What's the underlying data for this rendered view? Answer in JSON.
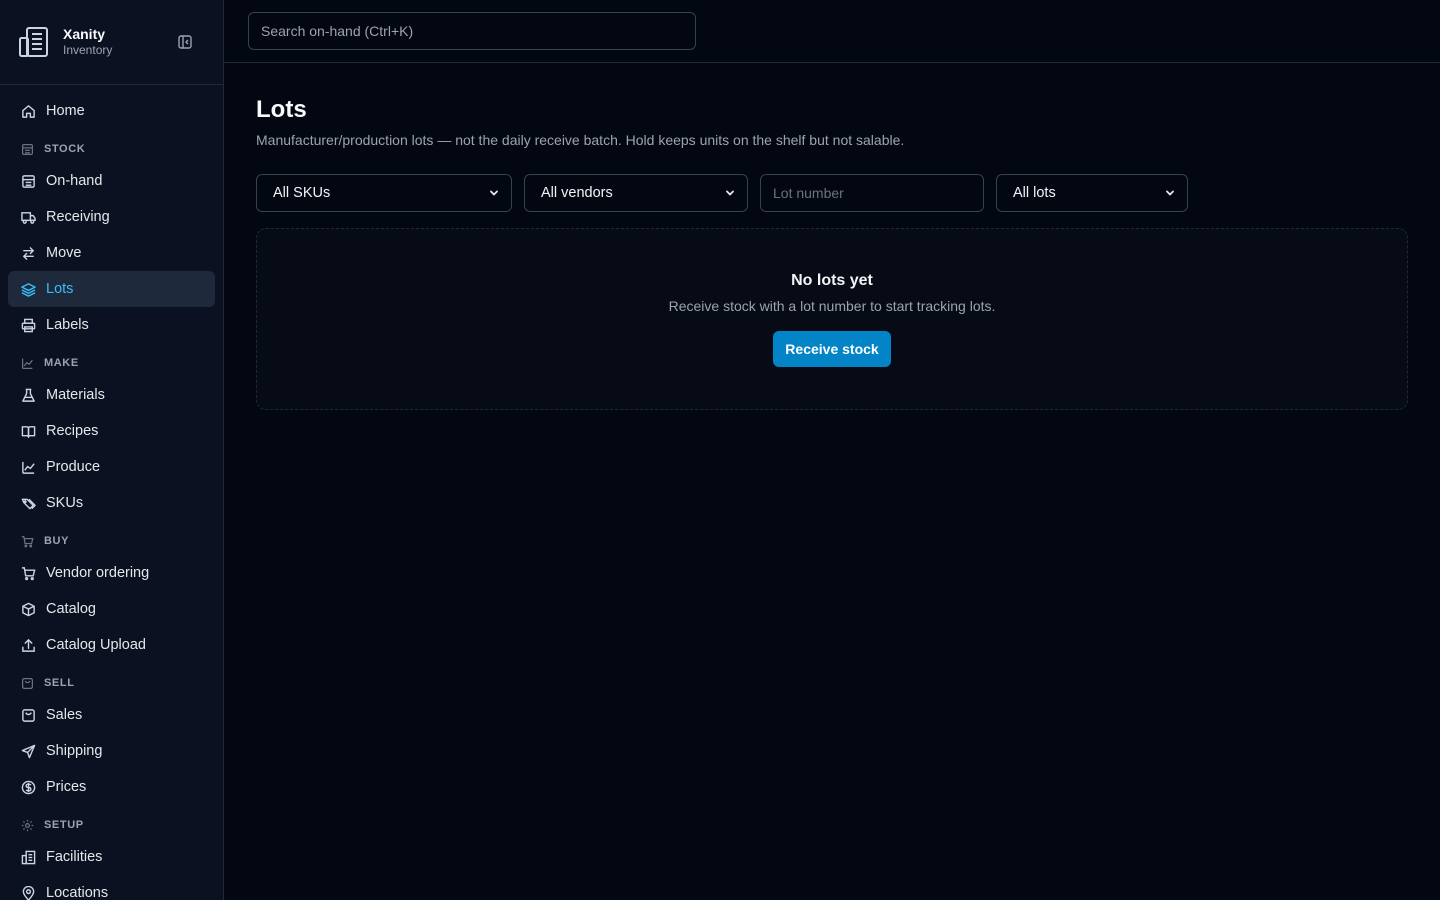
{
  "brand": {
    "name": "Xanity",
    "subtitle": "Inventory"
  },
  "search": {
    "placeholder": "Search on-hand (Ctrl+K)"
  },
  "sidebar": {
    "home": {
      "label": "Home",
      "icon": "home-icon"
    },
    "sections": [
      {
        "label": "STOCK",
        "icon": "warehouse-icon",
        "items": [
          {
            "label": "On-hand",
            "icon": "warehouse-icon"
          },
          {
            "label": "Receiving",
            "icon": "truck-icon"
          },
          {
            "label": "Move",
            "icon": "arrows-icon"
          },
          {
            "label": "Lots",
            "icon": "layers-icon",
            "active": true
          },
          {
            "label": "Labels",
            "icon": "printer-icon"
          }
        ]
      },
      {
        "label": "MAKE",
        "icon": "factory-icon",
        "items": [
          {
            "label": "Materials",
            "icon": "flask-icon"
          },
          {
            "label": "Recipes",
            "icon": "book-icon"
          },
          {
            "label": "Produce",
            "icon": "factory-icon"
          },
          {
            "label": "SKUs",
            "icon": "tags-icon"
          }
        ]
      },
      {
        "label": "BUY",
        "icon": "cart-icon",
        "items": [
          {
            "label": "Vendor ordering",
            "icon": "cart-icon"
          },
          {
            "label": "Catalog",
            "icon": "package-icon"
          },
          {
            "label": "Catalog Upload",
            "icon": "upload-icon"
          }
        ]
      },
      {
        "label": "SELL",
        "icon": "bag-icon",
        "items": [
          {
            "label": "Sales",
            "icon": "bag-icon"
          },
          {
            "label": "Shipping",
            "icon": "send-icon"
          },
          {
            "label": "Prices",
            "icon": "dollar-icon"
          }
        ]
      },
      {
        "label": "SETUP",
        "icon": "gear-icon",
        "items": [
          {
            "label": "Facilities",
            "icon": "building-icon"
          },
          {
            "label": "Locations",
            "icon": "pin-icon"
          }
        ]
      }
    ]
  },
  "page": {
    "title": "Lots",
    "description": "Manufacturer/production lots — not the daily receive batch. Hold keeps units on the shelf but not salable."
  },
  "filters": {
    "sku": "All SKUs",
    "vendor": "All vendors",
    "lot_placeholder": "Lot number",
    "lots": "All lots"
  },
  "empty": {
    "title": "No lots yet",
    "description": "Receive stock with a lot number to start tracking lots.",
    "button": "Receive stock"
  },
  "colors": {
    "accent": "#0284c7",
    "active_text": "#38bdf8",
    "bg": "#030712",
    "sidebar_bg": "#0b1120"
  }
}
